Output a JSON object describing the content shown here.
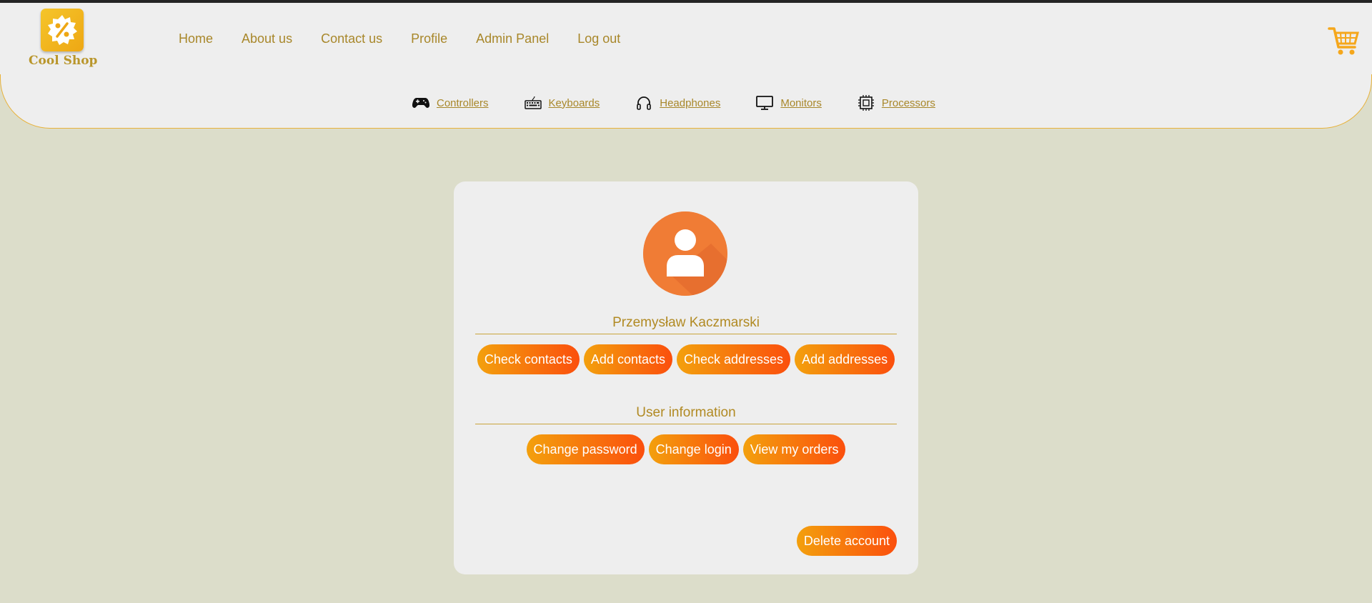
{
  "brand": {
    "name": "Cool Shop",
    "logo_icon": "percent-badge-icon"
  },
  "nav": {
    "items": [
      {
        "label": "Home"
      },
      {
        "label": "About us"
      },
      {
        "label": "Contact us"
      },
      {
        "label": "Profile"
      },
      {
        "label": "Admin Panel"
      },
      {
        "label": "Log out"
      }
    ]
  },
  "cart": {
    "icon": "shopping-cart-icon"
  },
  "categories": [
    {
      "label": "Controllers",
      "icon": "gamepad-icon"
    },
    {
      "label": "Keyboards",
      "icon": "keyboard-icon"
    },
    {
      "label": "Headphones",
      "icon": "headphones-icon"
    },
    {
      "label": "Monitors",
      "icon": "monitor-icon"
    },
    {
      "label": "Processors",
      "icon": "cpu-icon"
    }
  ],
  "profile": {
    "user_name": "Przemysław Kaczmarski",
    "contact_buttons": [
      {
        "label": "Check contacts"
      },
      {
        "label": "Add contacts"
      },
      {
        "label": "Check addresses"
      },
      {
        "label": "Add addresses"
      }
    ],
    "info_title": "User information",
    "info_buttons": [
      {
        "label": "Change password"
      },
      {
        "label": "Change login"
      },
      {
        "label": "View my orders"
      }
    ],
    "delete_label": "Delete account"
  },
  "colors": {
    "accent_text": "#a8872a",
    "button_gradient_start": "#f3a00d",
    "button_gradient_end": "#fb4f0d",
    "background": "#dcddca",
    "panel": "#eeeeee"
  }
}
